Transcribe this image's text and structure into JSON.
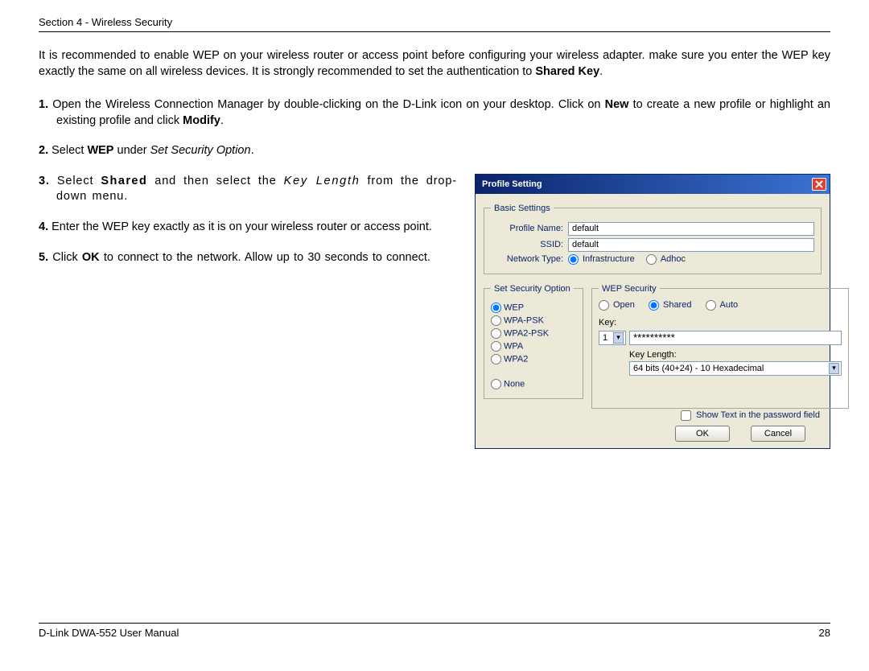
{
  "header": {
    "section": "Section 4 - Wireless Security"
  },
  "intro": {
    "t1": "It is recommended to enable WEP on your wireless router or access point before configuring your wireless adapter. make sure you enter the WEP key exactly the same on all wireless devices. It is strongly recommended to set the authentication to ",
    "shared_key": "Shared Key",
    "period": "."
  },
  "steps": {
    "s1a": "1.",
    "s1b": " Open the Wireless Connection Manager by double-clicking on the D-Link icon on your desktop. Click on ",
    "s1c": "New",
    "s1d": " to create a new profile or highlight an existing profile and click ",
    "s1e": "Modify",
    "s1f": ".",
    "s2a": "2.",
    "s2b": " Select ",
    "s2c": "WEP",
    "s2d": " under ",
    "s2e": "Set Security Option",
    "s2f": ".",
    "s3a": "3.",
    "s3b": " Select ",
    "s3c": "Shared",
    "s3d": " and then select the ",
    "s3e": "Key Length",
    "s3f": " from the drop-down menu.",
    "s4a": "4.",
    "s4b": " Enter the WEP key exactly as it is on your wireless router or access point.",
    "s5a": "5.",
    "s5b": " Click ",
    "s5c": "OK",
    "s5d": " to connect to the network. Allow up to 30 seconds to connect."
  },
  "dialog": {
    "title": "Profile Setting",
    "basic_legend": "Basic Settings",
    "profile_name_lbl": "Profile Name:",
    "profile_name_val": "default",
    "ssid_lbl": "SSID:",
    "ssid_val": "default",
    "network_type_lbl": "Network Type:",
    "nt_infra": "Infrastructure",
    "nt_adhoc": "Adhoc",
    "sec_legend": "Set Security Option",
    "sec_opts": {
      "wep": "WEP",
      "wpapsk": "WPA-PSK",
      "wpa2psk": "WPA2-PSK",
      "wpa": "WPA",
      "wpa2": "WPA2",
      "none": "None"
    },
    "wep_legend": "WEP Security",
    "wep_open": "Open",
    "wep_shared": "Shared",
    "wep_auto": "Auto",
    "key_lbl": "Key:",
    "key_index": "1",
    "key_value": "**********",
    "keylen_lbl": "Key Length:",
    "keylen_val": "64 bits (40+24) - 10 Hexadecimal",
    "show_text": "Show Text in the password field",
    "ok": "OK",
    "cancel": "Cancel"
  },
  "footer": {
    "manual": "D-Link DWA-552 User Manual",
    "page": "28"
  }
}
